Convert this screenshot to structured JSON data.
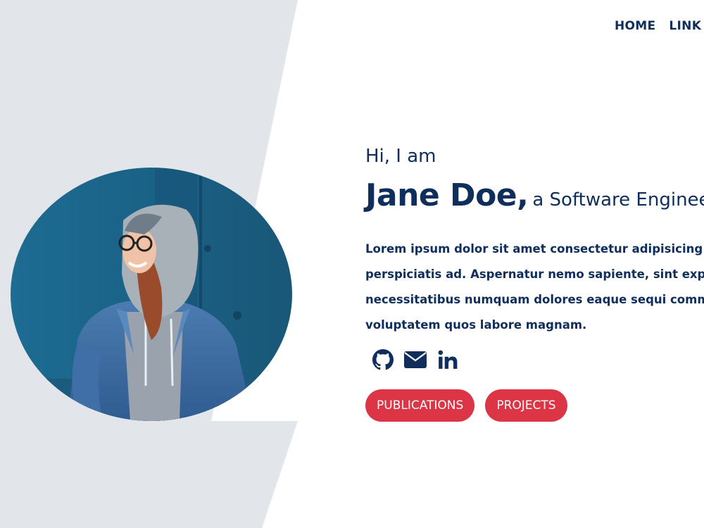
{
  "nav": {
    "items": [
      {
        "label": "HOME"
      },
      {
        "label": "LINK"
      }
    ]
  },
  "hero": {
    "greeting": "Hi, I am",
    "name": "Jane Doe,",
    "role": "a Software Engineer"
  },
  "bio": {
    "lines": [
      "Lorem ipsum dolor sit amet consectetur adipisicing elit",
      "perspiciatis ad. Aspernatur nemo sapiente, sint explicabo",
      "necessitatibus numquam dolores eaque sequi commodi",
      "voluptatem quos labore magnam."
    ]
  },
  "social": {
    "icons": [
      "github-icon",
      "envelope-icon",
      "linkedin-icon"
    ]
  },
  "buttons": {
    "publications": "PUBLICATIONS",
    "projects": "PROJECTS"
  },
  "colors": {
    "primary": "#0f2e5c",
    "accent": "#dc3545",
    "band": "#e2e6ea"
  }
}
